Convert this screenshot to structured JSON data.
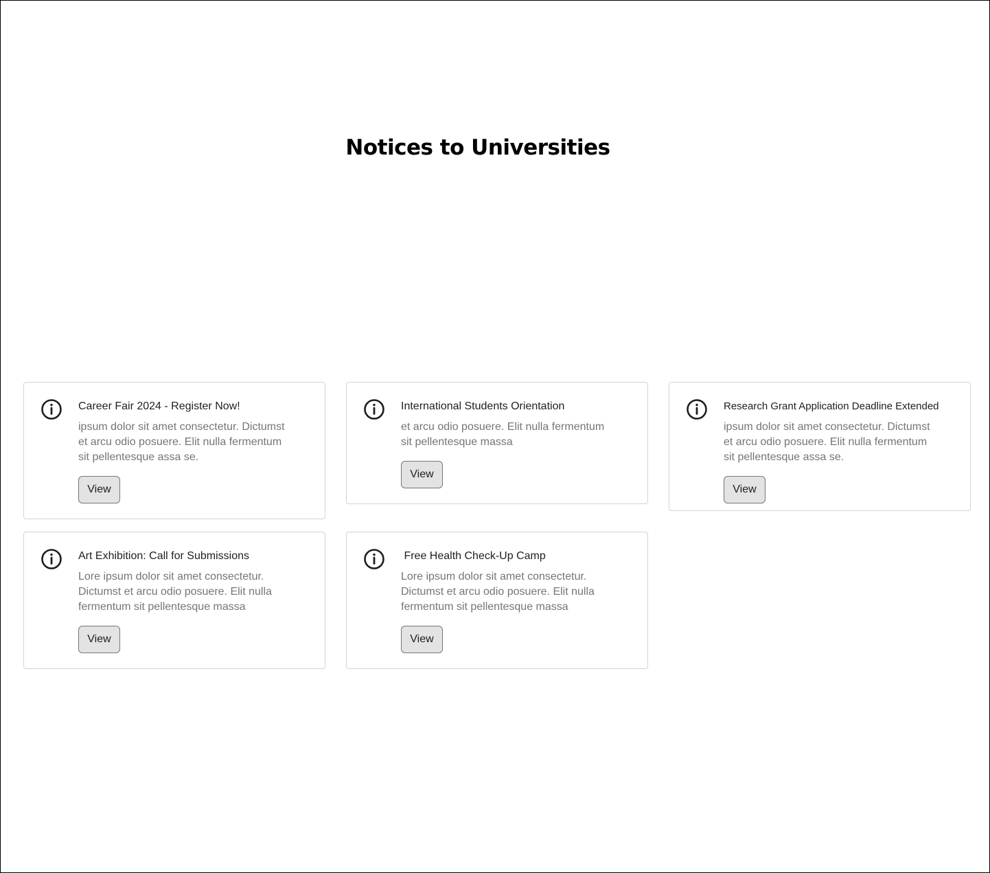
{
  "page": {
    "title": "Notices to Universities"
  },
  "notices": [
    {
      "title": "Career Fair 2024 - Register Now!",
      "description": " ipsum dolor sit amet consectetur. Dictumst\net arcu odio posuere. Elit nulla fermentum\nsit pellentesque assa se.",
      "button_label": "View",
      "icon": "info-icon"
    },
    {
      "title": "International Students Orientation",
      "description": "et arcu odio posuere. Elit nulla fermentum\nsit pellentesque massa",
      "button_label": "View",
      "icon": "info-icon"
    },
    {
      "title": "Research Grant Application Deadline Extended",
      "description": " ipsum dolor sit amet consectetur. Dictumst\net arcu odio posuere. Elit nulla fermentum\nsit pellentesque assa se.",
      "button_label": "View",
      "icon": "info-icon"
    },
    {
      "title": "Art Exhibition: Call for Submissions",
      "description": "Lore ipsum dolor sit amet consectetur.\nDictumst et arcu odio posuere. Elit nulla\nfermentum sit pellentesque massa",
      "button_label": "View",
      "icon": "info-icon"
    },
    {
      "title": " Free Health Check-Up Camp",
      "description": "Lore ipsum dolor sit amet consectetur.\nDictumst et arcu odio posuere. Elit nulla\nfermentum sit pellentesque massa",
      "button_label": "View",
      "icon": "info-icon"
    }
  ],
  "colors": {
    "card_border": "#d4d4d4",
    "title_text": "#1e1e1e",
    "description_text": "#757575",
    "button_fill": "#e3e3e3",
    "button_border": "#767676"
  }
}
